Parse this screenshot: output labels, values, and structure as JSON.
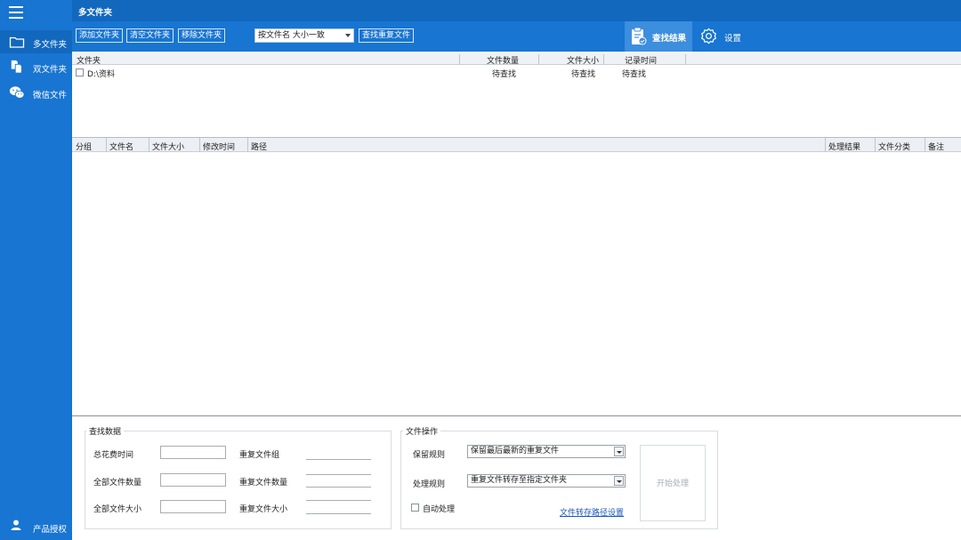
{
  "sidebar": {
    "items": [
      {
        "label": "多文件夹",
        "icon": "folder-icon"
      },
      {
        "label": "双文件夹",
        "icon": "file-compare-icon"
      },
      {
        "label": "微信文件",
        "icon": "wechat-icon"
      }
    ],
    "bottom": {
      "label": "产品授权",
      "icon": "user-icon"
    }
  },
  "header": {
    "title": "多文件夹",
    "buttons": {
      "add": "添加文件夹",
      "clear": "清空文件夹",
      "remove": "移除文件夹",
      "find": "查找重复文件"
    },
    "mode_select": "按文件名 大小一致",
    "tab_results": "查找结果",
    "tab_settings": "设置"
  },
  "folder_table": {
    "columns": [
      "文件夹",
      "文件数量",
      "文件大小",
      "记录时间"
    ],
    "rows": [
      {
        "folder": "D:\\资料",
        "count": "待查找",
        "size": "待查找",
        "time": "待查找"
      }
    ]
  },
  "results_table": {
    "columns": [
      "分组",
      "文件名",
      "文件大小",
      "修改时间",
      "路径",
      "处理结果",
      "文件分类",
      "备注"
    ]
  },
  "stats": {
    "title": "查找数据",
    "labels": {
      "elapsed": "总花费时间",
      "total_count": "全部文件数量",
      "total_size": "全部文件大小",
      "dup_groups": "重复文件组",
      "dup_count": "重复文件数量",
      "dup_size": "重复文件大小"
    }
  },
  "operations": {
    "title": "文件操作",
    "keep_rule_label": "保留规则",
    "keep_rule_value": "保留最后最新的重复文件",
    "handle_rule_label": "处理规则",
    "handle_rule_value": "重复文件转存至指定文件夹",
    "auto_label": "自动处理",
    "path_link": "文件转存路径设置",
    "start_button": "开始处理"
  },
  "colors": {
    "sidebar": "#1875d1",
    "titlebar": "#1268bd",
    "active_tab": "#3c8ede",
    "link": "#1a58b5"
  }
}
